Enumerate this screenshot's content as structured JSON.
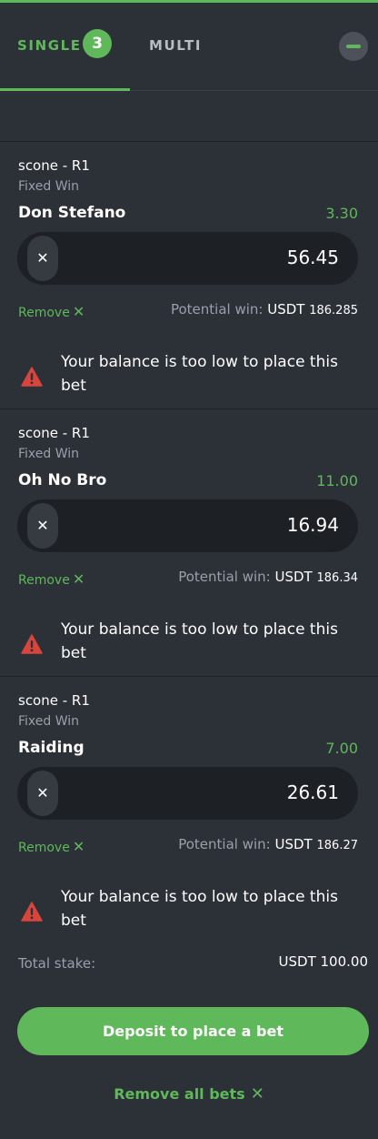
{
  "tabs": {
    "single_label": "SINGLE",
    "single_count": "3",
    "multi_label": "MULTI"
  },
  "bets": [
    {
      "meeting": "scone - R1",
      "bet_type": "Fixed Win",
      "runner": "Don Stefano",
      "odds": "3.30",
      "stake": "56.45",
      "remove_label": "Remove",
      "potential_label": "Potential win:",
      "currency": "USDT",
      "potential_amount": "186.285",
      "warning": "Your balance is too low to place this bet"
    },
    {
      "meeting": "scone - R1",
      "bet_type": "Fixed Win",
      "runner": "Oh No Bro",
      "odds": "11.00",
      "stake": "16.94",
      "remove_label": "Remove",
      "potential_label": "Potential win:",
      "currency": "USDT",
      "potential_amount": "186.34",
      "warning": "Your balance is too low to place this bet"
    },
    {
      "meeting": "scone - R1",
      "bet_type": "Fixed Win",
      "runner": "Raiding",
      "odds": "7.00",
      "stake": "26.61",
      "remove_label": "Remove",
      "potential_label": "Potential win:",
      "currency": "USDT",
      "potential_amount": "186.27",
      "warning": "Your balance is too low to place this bet"
    }
  ],
  "footer": {
    "total_label": "Total stake:",
    "total_value": "USDT 100.00",
    "deposit_label": "Deposit to place a bet",
    "remove_all_label": "Remove all bets"
  },
  "icons": {
    "clear": "close-icon",
    "remove": "close-icon",
    "warning": "warning-triangle-icon",
    "collapse": "minus-icon"
  },
  "colors": {
    "accent": "#5fb85a",
    "background": "#2c3037",
    "input": "#1d2025",
    "warning": "#d9443c"
  }
}
